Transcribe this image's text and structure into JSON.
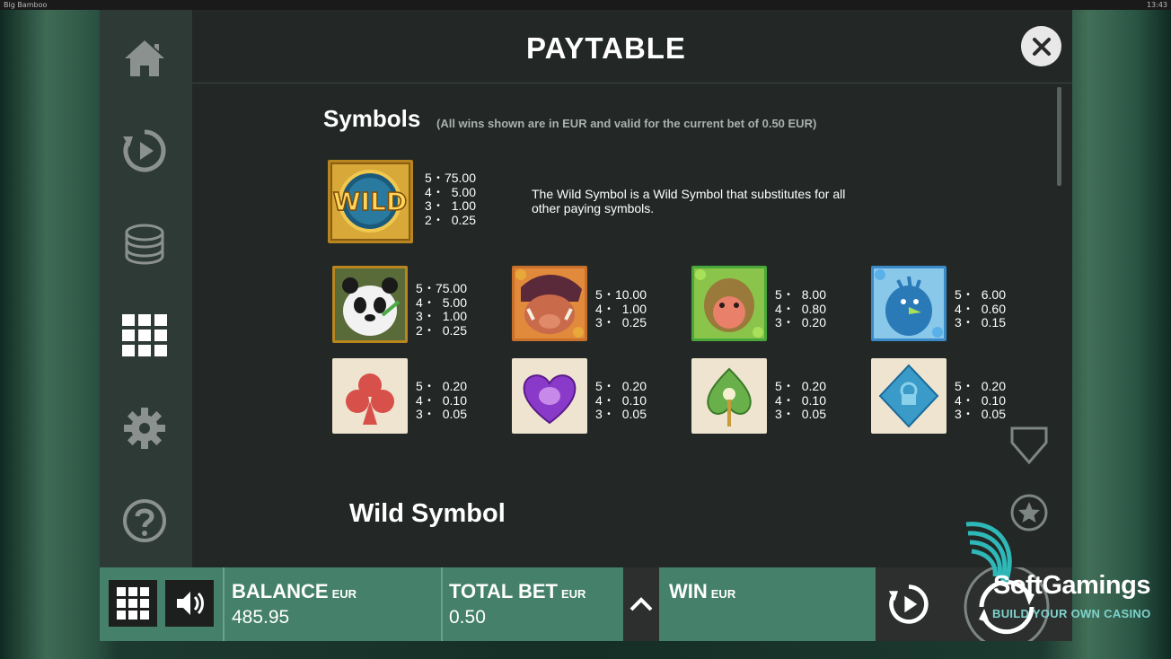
{
  "window": {
    "title": "Big Bamboo",
    "clock": "13:43"
  },
  "sidebar": {
    "items": [
      {
        "name": "home",
        "icon": "home-icon"
      },
      {
        "name": "autoplay",
        "icon": "autoplay-icon"
      },
      {
        "name": "bet",
        "icon": "coins-icon"
      },
      {
        "name": "paytable",
        "icon": "grid-icon",
        "active": true
      },
      {
        "name": "settings",
        "icon": "gear-icon"
      },
      {
        "name": "help",
        "icon": "help-icon"
      }
    ]
  },
  "paytable": {
    "title": "PAYTABLE",
    "section_title": "Symbols",
    "section_note": "(All wins shown are in EUR and valid for the current bet of 0.50 EUR)",
    "wild_description": "The Wild Symbol is a Wild Symbol that substitutes for all other paying symbols.",
    "sub_title": "Wild Symbol",
    "symbols": [
      {
        "name": "wild",
        "art_label": "WILD",
        "pays": [
          {
            "count": "5",
            "value": "75.00"
          },
          {
            "count": "4",
            "value": "5.00"
          },
          {
            "count": "3",
            "value": "1.00"
          },
          {
            "count": "2",
            "value": "0.25"
          }
        ]
      },
      {
        "name": "panda",
        "pays": [
          {
            "count": "5",
            "value": "75.00"
          },
          {
            "count": "4",
            "value": "5.00"
          },
          {
            "count": "3",
            "value": "1.00"
          },
          {
            "count": "2",
            "value": "0.25"
          }
        ]
      },
      {
        "name": "boar",
        "pays": [
          {
            "count": "5",
            "value": "10.00"
          },
          {
            "count": "4",
            "value": "1.00"
          },
          {
            "count": "3",
            "value": "0.25"
          }
        ]
      },
      {
        "name": "monkey",
        "pays": [
          {
            "count": "5",
            "value": "8.00"
          },
          {
            "count": "4",
            "value": "0.80"
          },
          {
            "count": "3",
            "value": "0.20"
          }
        ]
      },
      {
        "name": "bird",
        "pays": [
          {
            "count": "5",
            "value": "6.00"
          },
          {
            "count": "4",
            "value": "0.60"
          },
          {
            "count": "3",
            "value": "0.15"
          }
        ]
      },
      {
        "name": "club",
        "pays": [
          {
            "count": "5",
            "value": "0.20"
          },
          {
            "count": "4",
            "value": "0.10"
          },
          {
            "count": "3",
            "value": "0.05"
          }
        ]
      },
      {
        "name": "heart",
        "pays": [
          {
            "count": "5",
            "value": "0.20"
          },
          {
            "count": "4",
            "value": "0.10"
          },
          {
            "count": "3",
            "value": "0.05"
          }
        ]
      },
      {
        "name": "spade",
        "pays": [
          {
            "count": "5",
            "value": "0.20"
          },
          {
            "count": "4",
            "value": "0.10"
          },
          {
            "count": "3",
            "value": "0.05"
          }
        ]
      },
      {
        "name": "diamond",
        "pays": [
          {
            "count": "5",
            "value": "0.20"
          },
          {
            "count": "4",
            "value": "0.10"
          },
          {
            "count": "3",
            "value": "0.05"
          }
        ]
      }
    ]
  },
  "bottom_bar": {
    "balance_label": "BALANCE",
    "balance_unit": "EUR",
    "balance_value": "485.95",
    "total_bet_label": "TOTAL BET",
    "total_bet_unit": "EUR",
    "total_bet_value": "0.50",
    "win_label": "WIN",
    "win_unit": "EUR"
  },
  "watermark": {
    "brand": "SoftGamings",
    "tagline": "BUILD YOUR OWN CASINO"
  },
  "colors": {
    "accent_green": "#44806a",
    "panel": "#232826",
    "wild_gold": "#c9962a"
  }
}
